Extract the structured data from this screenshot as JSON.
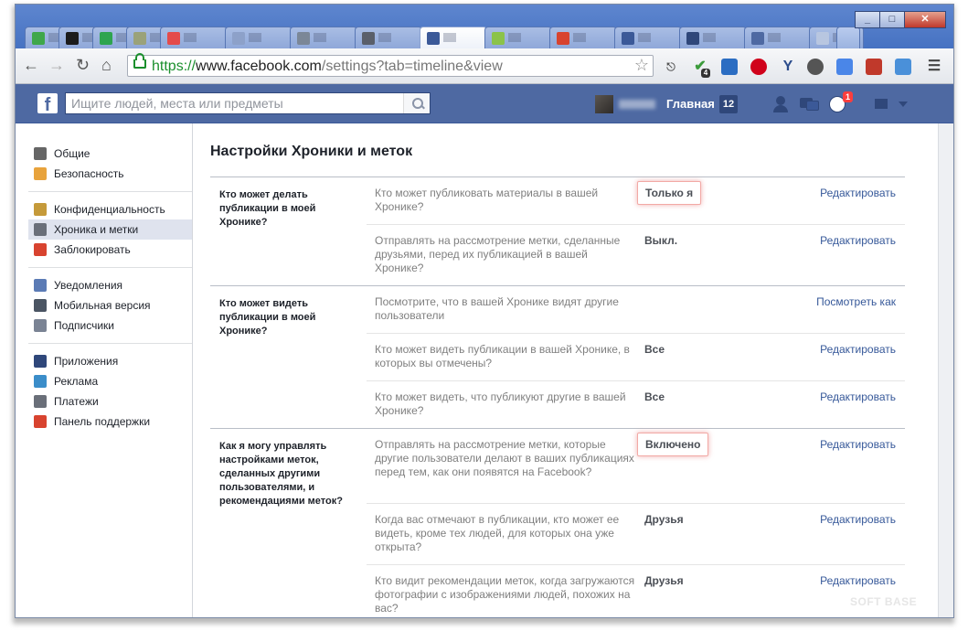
{
  "browser": {
    "url_scheme": "https://",
    "url_host": "www.facebook.com",
    "url_path": "/settings?tab=timeline&view",
    "window_buttons": [
      "_",
      "□",
      "✕"
    ],
    "extension_badge": "4"
  },
  "fb_header": {
    "logo": "f",
    "search_placeholder": "Ищите людей, места или предметы",
    "home_label": "Главная",
    "home_count": "12",
    "notifications_count": "1"
  },
  "sidebar": {
    "groups": [
      [
        {
          "label": "Общие",
          "icon": "gears-icon",
          "color": "#666666"
        },
        {
          "label": "Безопасность",
          "icon": "shield-icon",
          "color": "#e8a33c"
        }
      ],
      [
        {
          "label": "Конфиденциальность",
          "icon": "padlock-icon",
          "color": "#c59a3a"
        },
        {
          "label": "Хроника и метки",
          "icon": "timeline-icon",
          "color": "#6a6f79"
        },
        {
          "label": "Заблокировать",
          "icon": "block-icon",
          "color": "#d8432f"
        }
      ],
      [
        {
          "label": "Уведомления",
          "icon": "globe-icon",
          "color": "#5b7bb5"
        },
        {
          "label": "Мобильная версия",
          "icon": "mobile-icon",
          "color": "#4b5563"
        },
        {
          "label": "Подписчики",
          "icon": "rss-icon",
          "color": "#7a8394"
        }
      ],
      [
        {
          "label": "Приложения",
          "icon": "apps-icon",
          "color": "#2f477a"
        },
        {
          "label": "Реклама",
          "icon": "ads-icon",
          "color": "#3b8dc9"
        },
        {
          "label": "Платежи",
          "icon": "card-icon",
          "color": "#6a6f79"
        },
        {
          "label": "Панель поддержки",
          "icon": "lifebuoy-icon",
          "color": "#d8432f"
        }
      ]
    ],
    "selected_index": 1
  },
  "content": {
    "title": "Настройки Хроники и меток",
    "sections": [
      {
        "title": "Кто может делать публикации в моей Хронике?",
        "rows": [
          {
            "question": "Кто может публиковать материалы в вашей Хронике?",
            "value": "Только я",
            "action": "Редактировать",
            "highlight": true
          },
          {
            "question": "Отправлять на рассмотрение метки, сделанные друзьями, перед их публикацией в вашей Хронике?",
            "value": "Выкл.",
            "action": "Редактировать",
            "highlight": false
          }
        ]
      },
      {
        "title": "Кто может видеть публикации в моей Хронике?",
        "rows": [
          {
            "question": "Посмотрите, что в вашей Хронике видят другие пользователи",
            "value": "",
            "action": "Посмотреть как",
            "highlight": false
          },
          {
            "question": "Кто может видеть публикации в вашей Хронике, в которых вы отмечены?",
            "value": "Все",
            "action": "Редактировать",
            "highlight": false
          },
          {
            "question": "Кто может видеть, что публикуют другие в вашей Хронике?",
            "value": "Все",
            "action": "Редактировать",
            "highlight": false
          }
        ]
      },
      {
        "title": "Как я могу управлять настройками меток, сделанных другими пользователями, и рекомендациями меток?",
        "rows": [
          {
            "question": "Отправлять на рассмотрение метки, которые другие пользователи делают в ваших публикациях перед тем, как они появятся на Facebook?",
            "value": "Включено",
            "action": "Редактировать",
            "highlight": true
          },
          {
            "question": "Когда вас отмечают в публикации, кто может ее видеть, кроме тех людей, для которых она уже открыта?",
            "value": "Друзья",
            "action": "Редактировать",
            "highlight": false
          },
          {
            "question": "Кто видит рекомендации меток, когда загружаются фотографии с изображениями людей, похожих на вас?",
            "value": "Друзья",
            "action": "Редактировать",
            "highlight": false
          }
        ]
      }
    ]
  },
  "watermark": "SOFT BASE"
}
